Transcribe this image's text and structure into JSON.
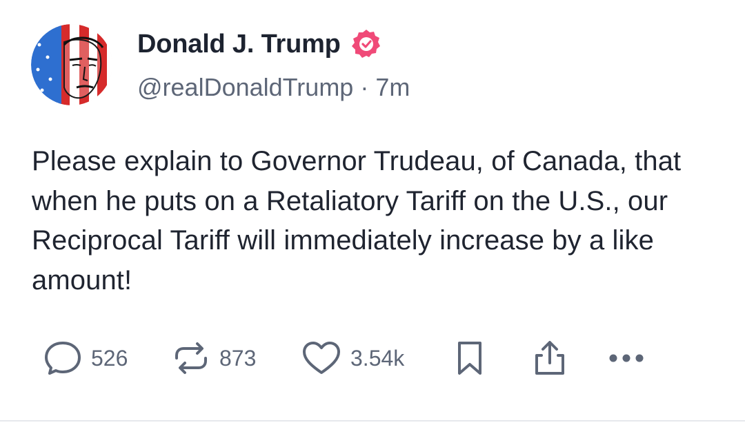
{
  "post": {
    "author": {
      "display_name": "Donald J. Trump",
      "handle": "@realDonaldTrump",
      "separator": "·",
      "time_ago": "7m",
      "verified": true,
      "avatar_icon": "flag-portrait-avatar"
    },
    "body": "Please explain to Governor Trudeau, of Canada, that when he puts on a Retaliatory Tariff on the U.S., our Reciprocal Tariff will immediately increase by a like amount!",
    "actions": {
      "reply": {
        "icon": "reply-bubble-icon",
        "count": "526"
      },
      "repost": {
        "icon": "repost-icon",
        "count": "873"
      },
      "like": {
        "icon": "heart-icon",
        "count": "3.54k"
      },
      "bookmark": {
        "icon": "bookmark-icon"
      },
      "share": {
        "icon": "share-icon"
      },
      "more": {
        "icon": "more-dots-icon"
      }
    }
  },
  "colors": {
    "text_primary": "#1f2430",
    "text_secondary": "#5d6677",
    "verified_badge": "#f04a78",
    "divider": "#e6e8ec",
    "background": "#ffffff"
  }
}
